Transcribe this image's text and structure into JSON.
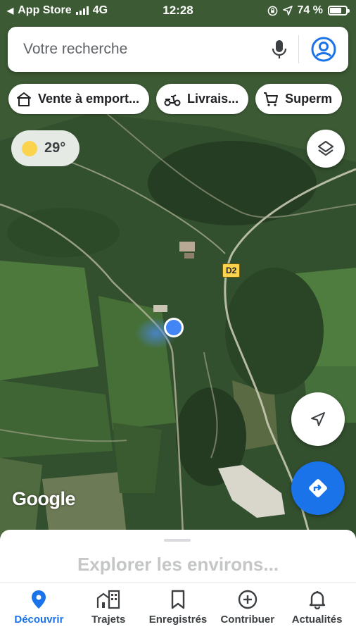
{
  "status_bar": {
    "carrier_back": "App Store",
    "network": "4G",
    "time": "12:28",
    "battery": "74 %",
    "battery_level": 0.74
  },
  "search": {
    "placeholder": "Votre recherche",
    "mic_icon": "microphone-icon",
    "account_icon": "account-circle-icon"
  },
  "chips": [
    {
      "label": "Vente à emport...",
      "icon": "takeout-icon"
    },
    {
      "label": "Livrais...",
      "icon": "scooter-icon"
    },
    {
      "label": "Superm",
      "icon": "cart-icon"
    }
  ],
  "weather": {
    "temperature": "29°",
    "icon": "sun-icon"
  },
  "map": {
    "road_label": "D2",
    "logo": "Google"
  },
  "sheet": {
    "title": "Explorer les environs..."
  },
  "tabs": [
    {
      "label": "Découvrir",
      "icon": "pin-icon",
      "active": true
    },
    {
      "label": "Trajets",
      "icon": "commute-icon",
      "active": false
    },
    {
      "label": "Enregistrés",
      "icon": "bookmark-icon",
      "active": false
    },
    {
      "label": "Contribuer",
      "icon": "add-circle-icon",
      "active": false
    },
    {
      "label": "Actualités",
      "icon": "bell-icon",
      "active": false
    }
  ],
  "colors": {
    "accent": "#1a73e8",
    "sun": "#fcd34d",
    "road_sign": "#fcd34d"
  }
}
